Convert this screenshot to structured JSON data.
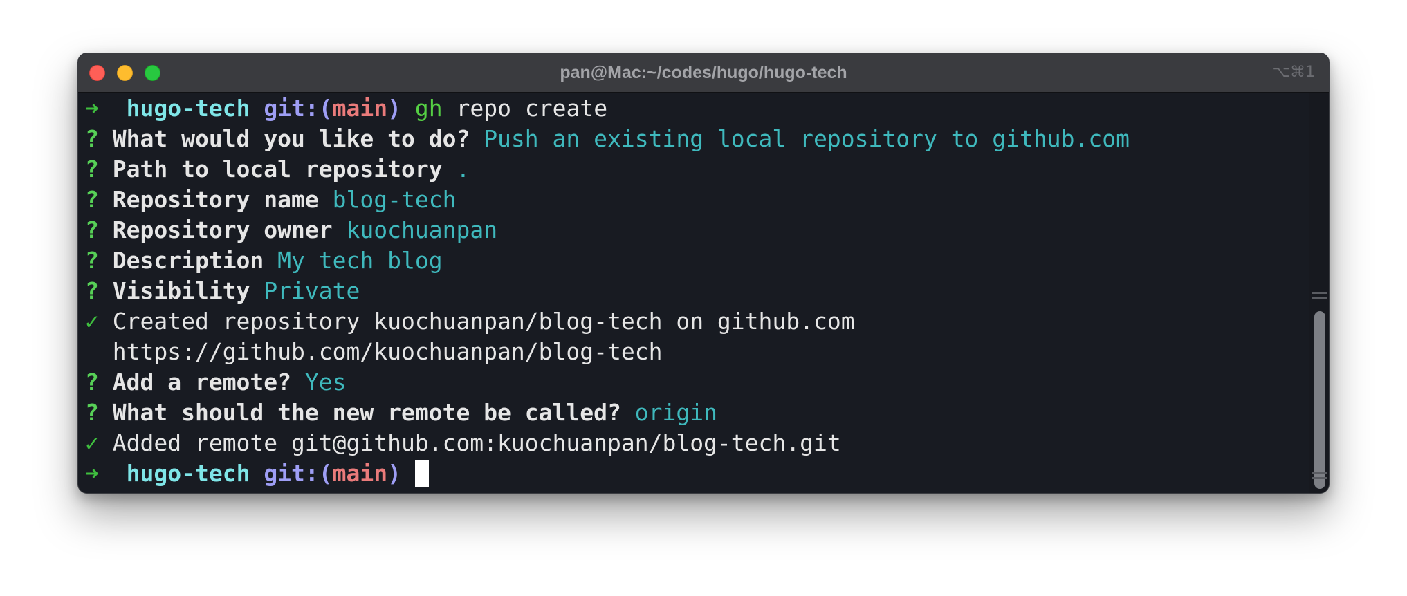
{
  "window": {
    "title": "pan@Mac:~/codes/hugo/hugo-tech",
    "shortcut": "⌥⌘1"
  },
  "terminal": {
    "prompt1": {
      "arrow": "➜",
      "dir": "hugo-tech",
      "git_label": "git:(",
      "branch": "main",
      "git_close": ")",
      "cmd_program": "gh",
      "cmd_args": "repo create"
    },
    "q_what": {
      "mark": "?",
      "question": "What would you like to do?",
      "answer": "Push an existing local repository to github.com"
    },
    "q_path": {
      "mark": "?",
      "question": "Path to local repository",
      "answer": "."
    },
    "q_name": {
      "mark": "?",
      "question": "Repository name",
      "answer": "blog-tech"
    },
    "q_owner": {
      "mark": "?",
      "question": "Repository owner",
      "answer": "kuochuanpan"
    },
    "q_desc": {
      "mark": "?",
      "question": "Description",
      "answer": "My tech blog"
    },
    "q_vis": {
      "mark": "?",
      "question": "Visibility",
      "answer": "Private"
    },
    "created": {
      "mark": "✓",
      "text": "Created repository kuochuanpan/blog-tech on github.com"
    },
    "url_line": {
      "text": "https://github.com/kuochuanpan/blog-tech"
    },
    "q_remote": {
      "mark": "?",
      "question": "Add a remote?",
      "answer": "Yes"
    },
    "q_remote_name": {
      "mark": "?",
      "question": "What should the new remote be called?",
      "answer": "origin"
    },
    "added": {
      "mark": "✓",
      "text": "Added remote git@github.com:kuochuanpan/blog-tech.git"
    },
    "prompt2": {
      "arrow": "➜",
      "dir": "hugo-tech",
      "git_label": "git:(",
      "branch": "main",
      "git_close": ")"
    }
  }
}
